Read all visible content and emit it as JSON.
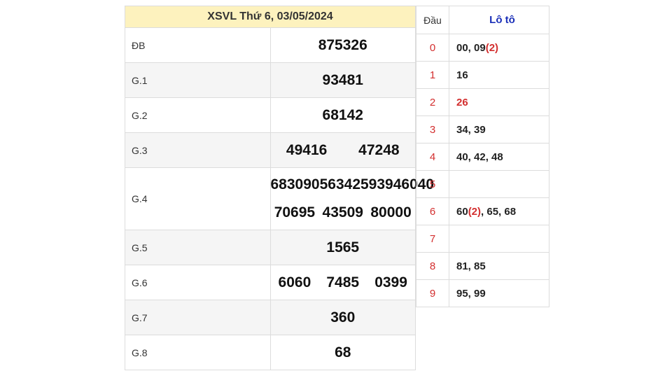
{
  "title": "XSVL Thứ 6, 03/05/2024",
  "prizes": {
    "db": {
      "label": "ĐB",
      "values": [
        "875326"
      ]
    },
    "g1": {
      "label": "G.1",
      "values": [
        "93481"
      ]
    },
    "g2": {
      "label": "G.2",
      "values": [
        "68142"
      ]
    },
    "g3": {
      "label": "G.3",
      "values": [
        "49416",
        "47248"
      ]
    },
    "g4": {
      "label": "G.4",
      "values": [
        "68309",
        "05634",
        "25939",
        "46040",
        "70695",
        "43509",
        "80000"
      ]
    },
    "g5": {
      "label": "G.5",
      "values": [
        "1565"
      ]
    },
    "g6": {
      "label": "G.6",
      "values": [
        "6060",
        "7485",
        "0399"
      ]
    },
    "g7": {
      "label": "G.7",
      "values": [
        "360"
      ]
    },
    "g8": {
      "label": "G.8",
      "values": [
        "68"
      ]
    }
  },
  "loto": {
    "header_dau": "Đầu",
    "header_loto": "Lô tô",
    "rows": [
      {
        "dau": "0",
        "a": "00, 09",
        "b": "(2)",
        "c": ""
      },
      {
        "dau": "1",
        "a": "16",
        "b": "",
        "c": ""
      },
      {
        "dau": "2",
        "a": "",
        "b": "26",
        "c": ""
      },
      {
        "dau": "3",
        "a": "34, 39",
        "b": "",
        "c": ""
      },
      {
        "dau": "4",
        "a": "40, 42, 48",
        "b": "",
        "c": ""
      },
      {
        "dau": "5",
        "a": "",
        "b": "",
        "c": ""
      },
      {
        "dau": "6",
        "a": "60",
        "b": "(2)",
        "c": ", 65, 68"
      },
      {
        "dau": "7",
        "a": "",
        "b": "",
        "c": ""
      },
      {
        "dau": "8",
        "a": "81, 85",
        "b": "",
        "c": ""
      },
      {
        "dau": "9",
        "a": "95, 99",
        "b": "",
        "c": ""
      }
    ]
  },
  "colors": {
    "accent_red": "#d32f2f",
    "header_bg": "#fdf2be",
    "loto_blue": "#1a2fb8"
  }
}
